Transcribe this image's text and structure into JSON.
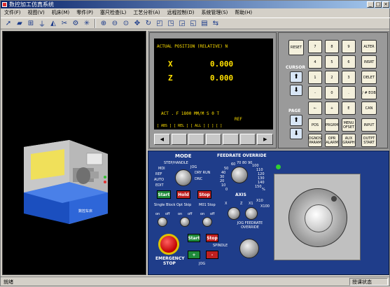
{
  "window": {
    "title": "数控加工仿真系统"
  },
  "menu": [
    "文件(F)",
    "视图(V)",
    "机床(M)",
    "零件(P)",
    "塞尺检查(L)",
    "工艺分析(A)",
    "远程控制(D)",
    "系统管理(S)",
    "帮助(H)"
  ],
  "toolbar_icons": [
    "cursor-icon",
    "eraser-icon",
    "part-icon",
    "tool-icon",
    "measure-icon",
    "tool-change-icon",
    "settings-icon",
    "light-icon",
    "zoom-in-icon",
    "zoom-out-icon",
    "zoom-window-icon",
    "pan-icon",
    "rotate-icon",
    "view-front-icon",
    "view-top-icon",
    "view-left-icon",
    "view-right-icon",
    "options-icon",
    "toggle-icon"
  ],
  "machine": {
    "label": "数控车床"
  },
  "screen": {
    "header": "ACTUAL  POSITION (RELATIVE)    N",
    "axes": [
      {
        "name": "X",
        "value": "0.000"
      },
      {
        "name": "Z",
        "value": "0.000"
      }
    ],
    "act_line": "ACT . F 1800  MM/M       S  0    T",
    "ref": "REF",
    "soft_labels": "[ ABS ]   [ REL ]   [ ALL ]   [        ]   [        ]"
  },
  "keypad": {
    "reset": "RESET",
    "cursor_label": "CURSOR",
    "page_label": "PAGE",
    "digits": [
      {
        "sym": "O",
        "main": "7",
        "sub": "N"
      },
      {
        "sym": "G",
        "main": "8",
        "sub": "/"
      },
      {
        "sym": "9",
        "main": "9",
        "sub": "F"
      },
      {
        "sym": "X",
        "main": "4",
        "sub": "U"
      },
      {
        "sym": "Z",
        "main": "5",
        "sub": "W"
      },
      {
        "sym": "6",
        "main": "6",
        "sub": "H"
      },
      {
        "sym": "M",
        "main": "1",
        "sub": "I"
      },
      {
        "sym": "S",
        "main": "2",
        "sub": "K"
      },
      {
        "sym": "T",
        "main": "3",
        "sub": "J"
      },
      {
        "sym": "-",
        "main": "-",
        "sub": "M"
      },
      {
        "sym": "0",
        "main": "0",
        "sub": "S"
      },
      {
        "sym": ".",
        "main": ".",
        "sub": "T"
      },
      {
        "sym": "P",
        "main": "←",
        "sub": "Q"
      },
      {
        "sym": "Q",
        "main": "+",
        "sub": "L"
      },
      {
        "sym": "#",
        "main": "E",
        "sub": "B"
      }
    ],
    "right_keys": [
      "ALTER",
      "INSRT",
      "DELET",
      "/ # EOB",
      "CAN",
      "INPUT",
      "OUTPT START"
    ],
    "func_keys": [
      "POS",
      "PRGRM",
      "MENU OFSET",
      "DGNOS PARAM",
      "OPR ALARM",
      "AUX GRAPH"
    ]
  },
  "operator": {
    "mode_label": "MODE",
    "modes": [
      "STEP/HANDLE",
      "JOG",
      "MDI",
      "DRY RUN",
      "REF",
      "DNC",
      "AUTO",
      "EDIT"
    ],
    "feed_label": "FEEDRATE OVERRIDE",
    "feed_ticks": [
      "60",
      "70",
      "80",
      "90",
      "100",
      "50",
      "110",
      "40",
      "120",
      "30",
      "130",
      "20",
      "140",
      "10",
      "150",
      "0",
      "%"
    ],
    "axis_label": "AXIS",
    "axis_marks": [
      "X",
      "Z",
      "X1",
      "X10",
      "X100"
    ],
    "start": "Start",
    "hold": "Hold",
    "stop": "Stop",
    "single_block": "Single Block",
    "opt_skip": "Opt Skip",
    "m01_stop": "M01 Stop",
    "on": "on",
    "off": "off",
    "spindle_label": "SPINDLE",
    "spindle_start": "Start",
    "spindle_stop": "Stop",
    "jog_label": "JOG",
    "jog_plus": "+",
    "jog_minus": "-",
    "jog_feed_label": "JOG FEEDRATE OVERRIDE",
    "emergency": "EMERGENCY STOP"
  },
  "status": {
    "left": "就绪",
    "right": "授课状态"
  },
  "colors": {
    "title_start": "#0a246a",
    "screen_text": "#ffe000",
    "panel_blue": "#1f3d8a",
    "start_green": "#1f8a3a",
    "hold_red": "#c02020"
  }
}
